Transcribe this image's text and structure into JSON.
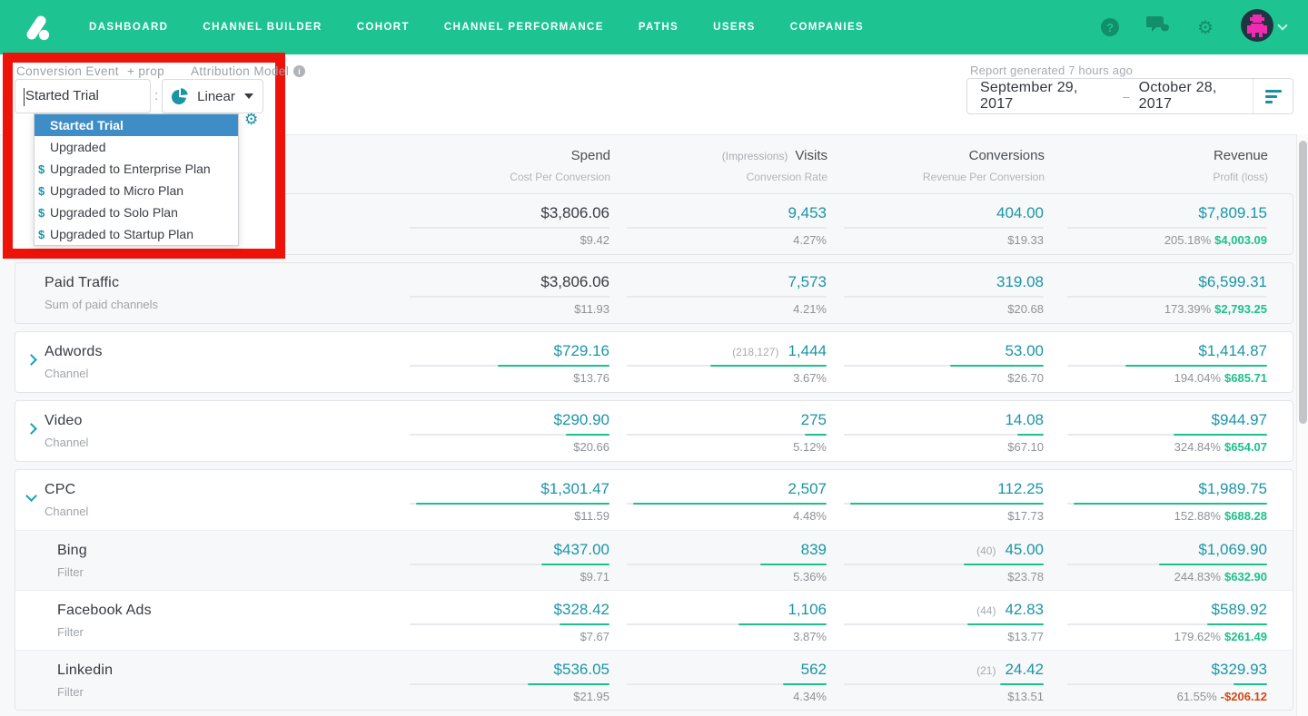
{
  "colors": {
    "nav_green": "#1dc492",
    "teal_value": "#1b95a6",
    "bar_green": "#1ec08b",
    "negative_red": "#d24a1a",
    "select_blue": "#3f8dc6",
    "highlight_red": "#ee1309"
  },
  "nav": {
    "items": [
      {
        "label": "DASHBOARD"
      },
      {
        "label": "CHANNEL BUILDER"
      },
      {
        "label": "COHORT"
      },
      {
        "label": "CHANNEL PERFORMANCE"
      },
      {
        "label": "PATHS"
      },
      {
        "label": "USERS"
      },
      {
        "label": "COMPANIES"
      }
    ],
    "help_icon": "?",
    "icons": [
      "help-icon",
      "chat-icon",
      "gear-icon",
      "avatar",
      "chevron-down-icon"
    ]
  },
  "controls": {
    "conversion_event_label": "Conversion Event",
    "add_prop_label": "+ prop",
    "conversion_event_value": "Started Trial",
    "separator": ":",
    "attribution_model_label": "Attribution Model",
    "model_value": "Linear",
    "dropdown": {
      "options": [
        {
          "prefix": "",
          "label": "Started Trial",
          "selected": true
        },
        {
          "prefix": "",
          "label": "Upgraded",
          "selected": false
        },
        {
          "prefix": "$",
          "label": "Upgraded to Enterprise Plan",
          "selected": false
        },
        {
          "prefix": "$",
          "label": "Upgraded to Micro Plan",
          "selected": false
        },
        {
          "prefix": "$",
          "label": "Upgraded to Solo Plan",
          "selected": false
        },
        {
          "prefix": "$",
          "label": "Upgraded to Startup Plan",
          "selected": false
        }
      ]
    }
  },
  "report": {
    "generated": "Report generated 7 hours ago",
    "date_start": "September 29, 2017",
    "date_dash": "–",
    "date_end": "October 28, 2017"
  },
  "table": {
    "columns": [
      {
        "pre": "",
        "main": "Spend",
        "sub": "Cost Per Conversion"
      },
      {
        "pre": "(Impressions)",
        "main": "Visits",
        "sub": "Conversion Rate"
      },
      {
        "pre": "",
        "main": "Conversions",
        "sub": "Revenue Per Conversion"
      },
      {
        "pre": "",
        "main": "Revenue",
        "sub": "Profit (loss)"
      }
    ],
    "rows": [
      {
        "label": "",
        "sublabel": "",
        "spend": {
          "main": "$3,806.06",
          "sub": "$9.42"
        },
        "visits": {
          "note": "",
          "main": "9,453",
          "sub": "4.27%"
        },
        "conversions": {
          "note": "",
          "main": "404.00",
          "sub": "$19.33"
        },
        "revenue": {
          "main": "$7,809.15",
          "pct": "205.18%",
          "profit": "$4,003.09"
        },
        "bars": {
          "spend": 0,
          "visits": 0,
          "conversions": 0,
          "revenue": 0
        }
      },
      {
        "label": "Paid Traffic",
        "sublabel": "Sum of paid channels",
        "spend": {
          "main": "$3,806.06",
          "sub": "$11.93"
        },
        "visits": {
          "note": "",
          "main": "7,573",
          "sub": "4.21%"
        },
        "conversions": {
          "note": "",
          "main": "319.08",
          "sub": "$20.68"
        },
        "revenue": {
          "main": "$6,599.31",
          "pct": "173.39%",
          "profit": "$2,793.25"
        },
        "bars": {
          "spend": 0,
          "visits": 0,
          "conversions": 0,
          "revenue": 0
        }
      },
      {
        "label": "Adwords",
        "sublabel": "Channel",
        "spend": {
          "main": "$729.16",
          "sub": "$13.76"
        },
        "visits": {
          "note": "(218,127)",
          "main": "1,444",
          "sub": "3.67%"
        },
        "conversions": {
          "note": "",
          "main": "53.00",
          "sub": "$26.70"
        },
        "revenue": {
          "main": "$1,414.87",
          "pct": "194.04%",
          "profit": "$685.71"
        },
        "bars": {
          "spend": 56,
          "visits": 58,
          "conversions": 47,
          "revenue": 71
        }
      },
      {
        "label": "Video",
        "sublabel": "Channel",
        "spend": {
          "main": "$290.90",
          "sub": "$20.66"
        },
        "visits": {
          "note": "",
          "main": "275",
          "sub": "5.12%"
        },
        "conversions": {
          "note": "",
          "main": "14.08",
          "sub": "$67.10"
        },
        "revenue": {
          "main": "$944.97",
          "pct": "324.84%",
          "profit": "$654.07"
        },
        "bars": {
          "spend": 22,
          "visits": 11,
          "conversions": 13,
          "revenue": 47
        }
      },
      {
        "label": "CPC",
        "sublabel": "Channel",
        "spend": {
          "main": "$1,301.47",
          "sub": "$11.59"
        },
        "visits": {
          "note": "",
          "main": "2,507",
          "sub": "4.48%"
        },
        "conversions": {
          "note": "",
          "main": "112.25",
          "sub": "$17.73"
        },
        "revenue": {
          "main": "$1,989.75",
          "pct": "152.88%",
          "profit": "$688.28"
        },
        "bars": {
          "spend": 97,
          "visits": 97,
          "conversions": 97,
          "revenue": 97
        }
      },
      {
        "label": "Bing",
        "sublabel": "Filter",
        "spend": {
          "main": "$437.00",
          "sub": "$9.71"
        },
        "visits": {
          "note": "",
          "main": "839",
          "sub": "5.36%"
        },
        "conversions": {
          "note": "(40)",
          "main": "45.00",
          "sub": "$23.78"
        },
        "revenue": {
          "main": "$1,069.90",
          "pct": "244.83%",
          "profit": "$632.90"
        },
        "bars": {
          "spend": 34,
          "visits": 33,
          "conversions": 40,
          "revenue": 54
        }
      },
      {
        "label": "Facebook Ads",
        "sublabel": "Filter",
        "spend": {
          "main": "$328.42",
          "sub": "$7.67"
        },
        "visits": {
          "note": "",
          "main": "1,106",
          "sub": "3.87%"
        },
        "conversions": {
          "note": "(44)",
          "main": "42.83",
          "sub": "$13.77"
        },
        "revenue": {
          "main": "$589.92",
          "pct": "179.62%",
          "profit": "$261.49"
        },
        "bars": {
          "spend": 25,
          "visits": 44,
          "conversions": 38,
          "revenue": 30
        }
      },
      {
        "label": "Linkedin",
        "sublabel": "Filter",
        "spend": {
          "main": "$536.05",
          "sub": "$21.95"
        },
        "visits": {
          "note": "",
          "main": "562",
          "sub": "4.34%"
        },
        "conversions": {
          "note": "(21)",
          "main": "24.42",
          "sub": "$13.51"
        },
        "revenue": {
          "main": "$329.93",
          "pct": "61.55%",
          "profit": "-$206.12"
        },
        "bars": {
          "spend": 41,
          "visits": 22,
          "conversions": 22,
          "revenue": 17
        }
      }
    ]
  }
}
